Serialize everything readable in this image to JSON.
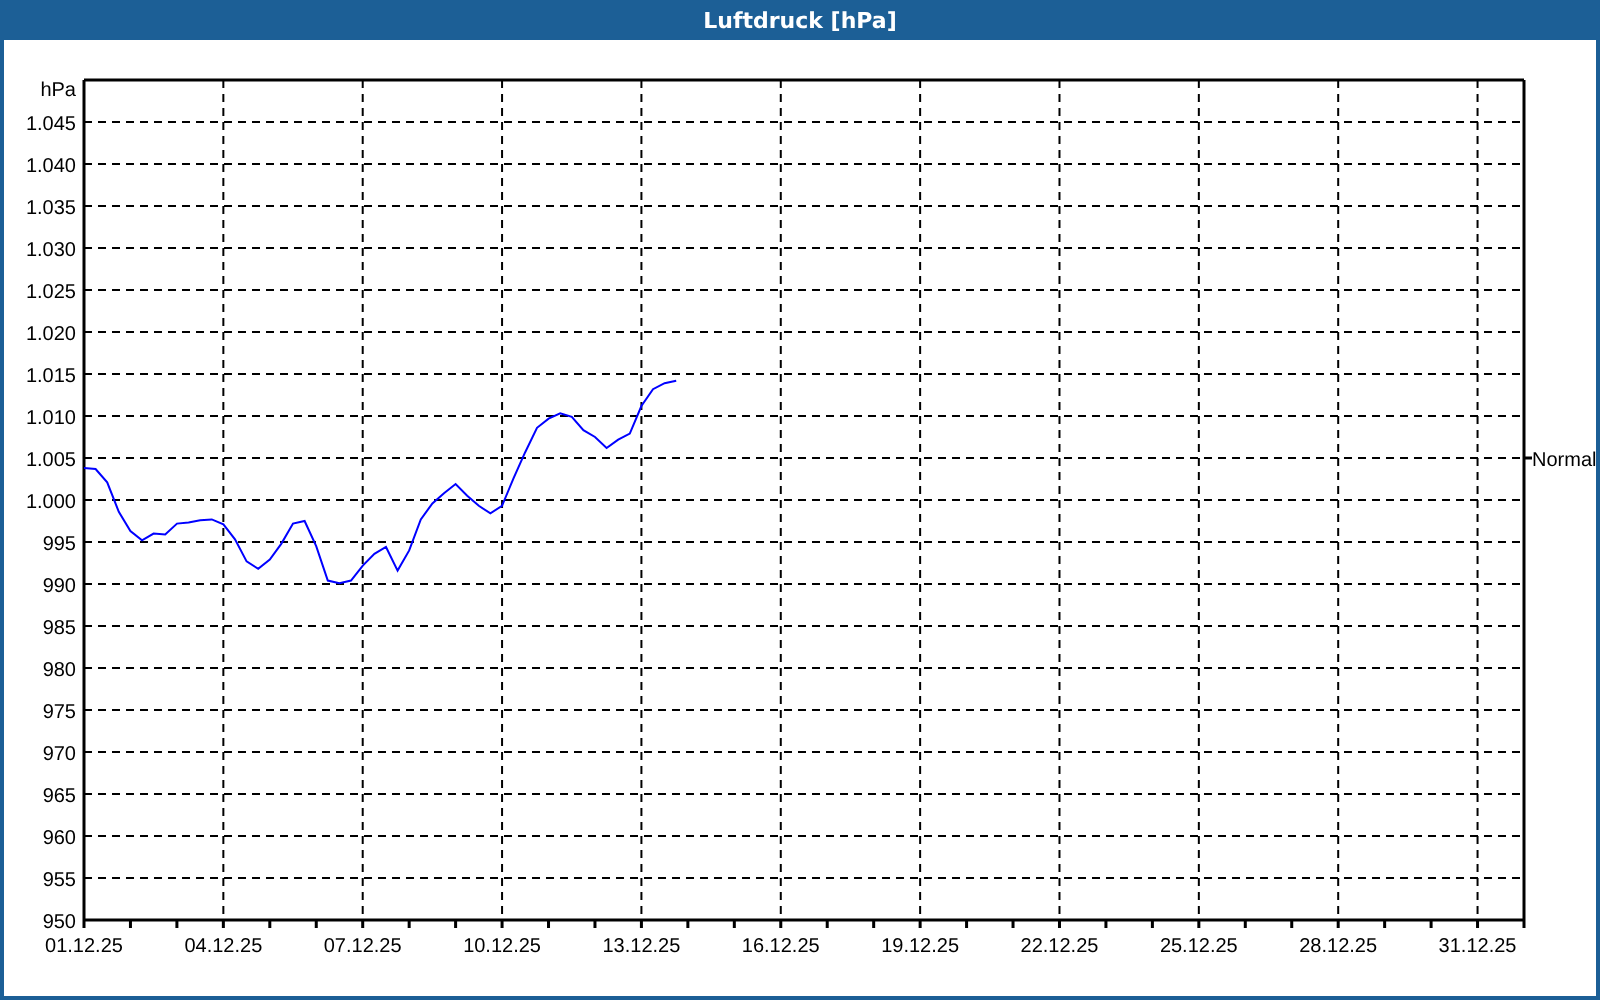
{
  "window": {
    "title": "Luftdruck [hPa]"
  },
  "chart": {
    "chart_data": {
      "type": "line",
      "ylabel": "hPa",
      "ylim": [
        950,
        1050
      ],
      "categories": [
        "01.12.25",
        null,
        null,
        null,
        null,
        null,
        null,
        null,
        null,
        null,
        null,
        null,
        "04.12.25",
        null,
        null,
        null,
        null,
        null,
        null,
        null,
        null,
        null,
        null,
        null,
        "07.12.25",
        null,
        null,
        null,
        null,
        null,
        null,
        null,
        null,
        null,
        null,
        null,
        "10.12.25",
        null,
        null,
        null,
        null,
        null,
        null,
        null,
        null,
        null,
        null,
        null,
        "13.12.25",
        null,
        null,
        null,
        null,
        null,
        null,
        null,
        null,
        null,
        null,
        null,
        "16.12.25",
        null,
        null,
        null,
        null,
        null,
        null,
        null,
        null,
        null,
        null,
        null,
        "19.12.25",
        null,
        null,
        null,
        null,
        null,
        null,
        null,
        null,
        null,
        null,
        null,
        "22.12.25",
        null,
        null,
        null,
        null,
        null,
        null,
        null,
        null,
        null,
        null,
        null,
        "25.12.25",
        null,
        null,
        null,
        null,
        null,
        null,
        null,
        null,
        null,
        null,
        null,
        "28.12.25",
        null,
        null,
        null,
        null,
        null,
        null,
        null,
        null,
        null,
        null,
        null,
        "31.12.25",
        null,
        null,
        null,
        null
      ],
      "yticks": [
        {
          "value": 950,
          "label": "950"
        },
        {
          "value": 955,
          "label": "955"
        },
        {
          "value": 960,
          "label": "960"
        },
        {
          "value": 965,
          "label": "965"
        },
        {
          "value": 970,
          "label": "970"
        },
        {
          "value": 975,
          "label": "975"
        },
        {
          "value": 980,
          "label": "980"
        },
        {
          "value": 985,
          "label": "985"
        },
        {
          "value": 990,
          "label": "990"
        },
        {
          "value": 995,
          "label": "995"
        },
        {
          "value": 1000,
          "label": "1.000"
        },
        {
          "value": 1005,
          "label": "1.005"
        },
        {
          "value": 1010,
          "label": "1.010"
        },
        {
          "value": 1015,
          "label": "1.015"
        },
        {
          "value": 1020,
          "label": "1.020"
        },
        {
          "value": 1025,
          "label": "1.025"
        },
        {
          "value": 1030,
          "label": "1.030"
        },
        {
          "value": 1035,
          "label": "1.035"
        },
        {
          "value": 1040,
          "label": "1.040"
        },
        {
          "value": 1045,
          "label": "1.045"
        }
      ],
      "series": [
        {
          "color": "#0000ff",
          "values": [
            1003.8,
            1003.7,
            1002.1,
            998.6,
            996.3,
            995.2,
            996.0,
            995.9,
            997.2,
            997.3,
            997.6,
            997.7,
            997.1,
            995.3,
            992.7,
            991.8,
            992.9,
            994.8,
            997.2,
            997.5,
            994.5,
            990.4,
            990.1,
            990.4,
            992.2,
            993.6,
            994.4,
            991.6,
            994.0,
            997.7,
            999.6,
            1000.8,
            1001.9,
            1000.5,
            999.3,
            998.4,
            999.3,
            1002.6,
            1005.7,
            1008.6,
            1009.7,
            1010.3,
            1009.9,
            1008.3,
            1007.5,
            1006.2,
            1007.2,
            1007.9,
            1011.2,
            1013.2,
            1013.9,
            1014.2,
            null,
            null,
            null,
            null,
            null,
            null,
            null,
            null,
            null,
            null,
            null,
            null,
            null,
            null,
            null,
            null,
            null,
            null,
            null,
            null,
            null,
            null,
            null,
            null,
            null,
            null,
            null,
            null,
            null,
            null,
            null,
            null,
            null,
            null,
            null,
            null,
            null,
            null,
            null,
            null,
            null,
            null,
            null,
            null,
            null,
            null,
            null,
            null,
            null,
            null,
            null,
            null,
            null,
            null,
            null,
            null,
            null,
            null,
            null,
            null,
            null,
            null,
            null,
            null,
            null,
            null,
            null,
            null,
            null,
            null,
            null,
            null,
            null
          ]
        }
      ],
      "grid": true,
      "annotations": [
        "Normal"
      ]
    }
  }
}
